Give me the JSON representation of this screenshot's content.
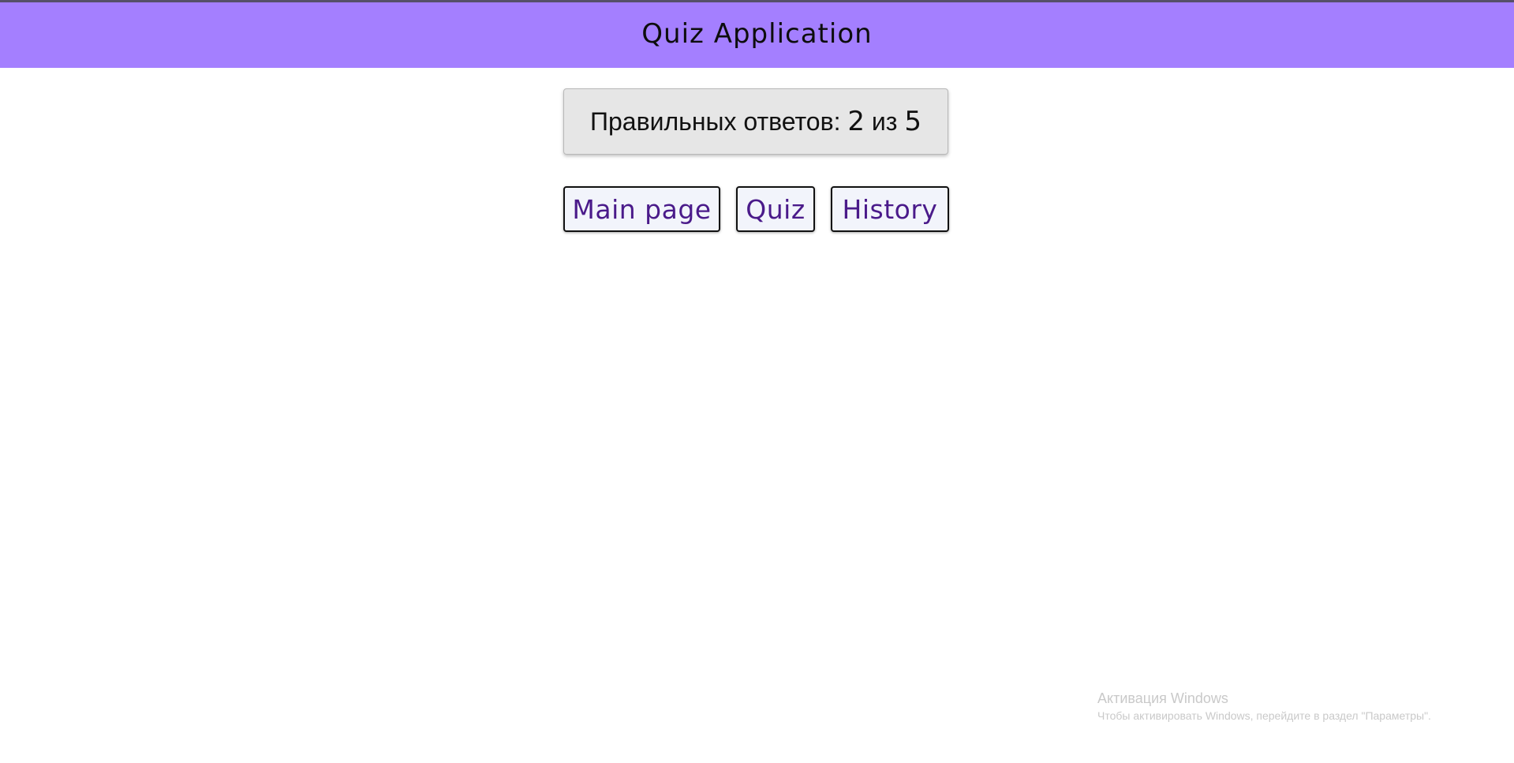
{
  "header": {
    "title": "Quiz Application"
  },
  "result": {
    "label": "Правильных ответов:",
    "correct": "2",
    "separator": "из",
    "total": "5"
  },
  "nav": {
    "main_page_label": "Main page",
    "quiz_label": "Quiz",
    "history_label": "History"
  },
  "watermark": {
    "title": "Активация Windows",
    "subtitle": "Чтобы активировать Windows, перейдите в раздел \"Параметры\"."
  },
  "colors": {
    "header_bg": "#a47fff",
    "button_text": "#4a1a8a",
    "result_bg": "#e6e6e6"
  }
}
